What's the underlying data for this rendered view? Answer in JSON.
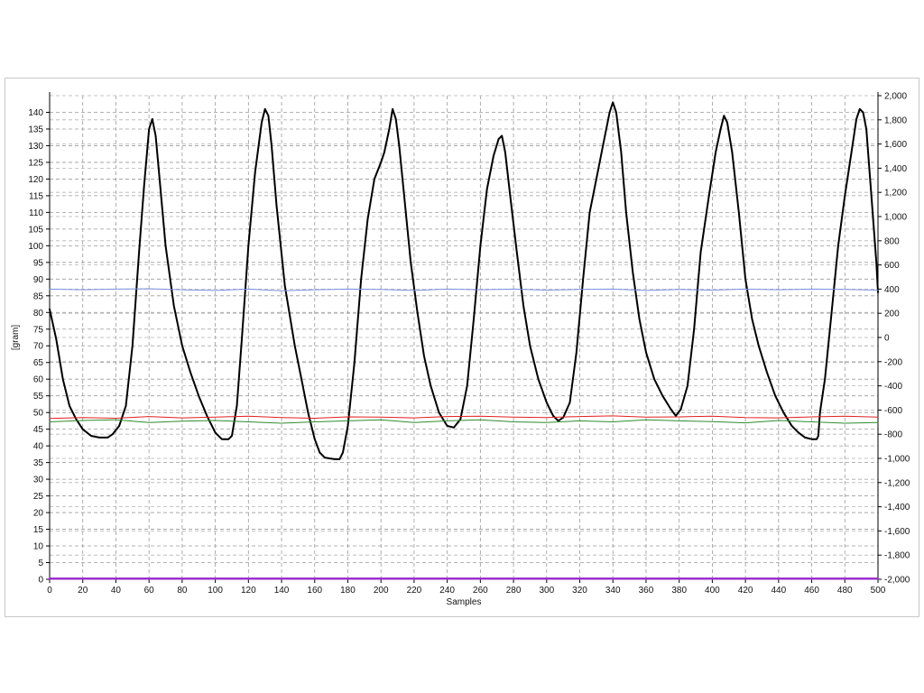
{
  "chart_data": {
    "type": "line",
    "title": "",
    "xlabel": "Samples",
    "ylabel": "[gram]",
    "xlim": [
      0,
      500
    ],
    "ylim": [
      0,
      145
    ],
    "y2lim": [
      -2000,
      2000
    ],
    "x_ticks": [
      "0",
      "20",
      "40",
      "60",
      "80",
      "100",
      "120",
      "140",
      "160",
      "180",
      "200",
      "220",
      "240",
      "260",
      "280",
      "300",
      "320",
      "340",
      "360",
      "380",
      "400",
      "420",
      "440",
      "460",
      "480",
      "500"
    ],
    "y_ticks": [
      "0",
      "5",
      "10",
      "15",
      "20",
      "25",
      "30",
      "35",
      "40",
      "45",
      "50",
      "55",
      "60",
      "65",
      "70",
      "75",
      "80",
      "85",
      "90",
      "95",
      "100",
      "105",
      "110",
      "115",
      "120",
      "125",
      "130",
      "135",
      "140"
    ],
    "y2_ticks": [
      "-2,000",
      "-1,800",
      "-1,600",
      "-1,400",
      "-1,200",
      "-1,000",
      "-800",
      "-600",
      "-400",
      "-200",
      "0",
      "200",
      "400",
      "600",
      "800",
      "1,000",
      "1,200",
      "1,400",
      "1,600",
      "1,800",
      "2,000"
    ],
    "grid": true,
    "series": [
      {
        "color": "#000000",
        "axis": "left",
        "points": [
          [
            0,
            81
          ],
          [
            4,
            72
          ],
          [
            8,
            60
          ],
          [
            12,
            52
          ],
          [
            16,
            48
          ],
          [
            20,
            45
          ],
          [
            25,
            43
          ],
          [
            30,
            42.5
          ],
          [
            35,
            42.5
          ],
          [
            38,
            43.5
          ],
          [
            42,
            46
          ],
          [
            46,
            52
          ],
          [
            50,
            70
          ],
          [
            54,
            98
          ],
          [
            57,
            118
          ],
          [
            60,
            135
          ],
          [
            62,
            138
          ],
          [
            64,
            133
          ],
          [
            66,
            122
          ],
          [
            70,
            100
          ],
          [
            75,
            82
          ],
          [
            80,
            70
          ],
          [
            85,
            62
          ],
          [
            90,
            55
          ],
          [
            95,
            49
          ],
          [
            100,
            44
          ],
          [
            104,
            42
          ],
          [
            108,
            42
          ],
          [
            110,
            43
          ],
          [
            113,
            52
          ],
          [
            116,
            72
          ],
          [
            120,
            100
          ],
          [
            124,
            122
          ],
          [
            128,
            137
          ],
          [
            130,
            141
          ],
          [
            132,
            139
          ],
          [
            134,
            130
          ],
          [
            137,
            112
          ],
          [
            142,
            88
          ],
          [
            148,
            70
          ],
          [
            152,
            60
          ],
          [
            156,
            50
          ],
          [
            160,
            42
          ],
          [
            163,
            38
          ],
          [
            166,
            36.5
          ],
          [
            172,
            36
          ],
          [
            175,
            36
          ],
          [
            177,
            38
          ],
          [
            180,
            46
          ],
          [
            184,
            65
          ],
          [
            188,
            90
          ],
          [
            192,
            108
          ],
          [
            196,
            120
          ],
          [
            200,
            125
          ],
          [
            202,
            128
          ],
          [
            205,
            135
          ],
          [
            207,
            141
          ],
          [
            209,
            138
          ],
          [
            211,
            130
          ],
          [
            214,
            115
          ],
          [
            218,
            95
          ],
          [
            222,
            80
          ],
          [
            226,
            67
          ],
          [
            230,
            58
          ],
          [
            235,
            50
          ],
          [
            240,
            46
          ],
          [
            244,
            45.5
          ],
          [
            248,
            48
          ],
          [
            252,
            58
          ],
          [
            256,
            78
          ],
          [
            260,
            100
          ],
          [
            264,
            117
          ],
          [
            268,
            127
          ],
          [
            271,
            132
          ],
          [
            273,
            133
          ],
          [
            275,
            128
          ],
          [
            278,
            115
          ],
          [
            282,
            98
          ],
          [
            286,
            82
          ],
          [
            290,
            70
          ],
          [
            295,
            60
          ],
          [
            300,
            53
          ],
          [
            304,
            49
          ],
          [
            307,
            47.5
          ],
          [
            310,
            48.5
          ],
          [
            314,
            53
          ],
          [
            318,
            68
          ],
          [
            322,
            90
          ],
          [
            326,
            110
          ],
          [
            330,
            120
          ],
          [
            334,
            130
          ],
          [
            338,
            140
          ],
          [
            340,
            143
          ],
          [
            342,
            140
          ],
          [
            345,
            128
          ],
          [
            348,
            110
          ],
          [
            352,
            92
          ],
          [
            356,
            78
          ],
          [
            360,
            68
          ],
          [
            365,
            60
          ],
          [
            370,
            55
          ],
          [
            375,
            51
          ],
          [
            378,
            49
          ],
          [
            381,
            51
          ],
          [
            385,
            58
          ],
          [
            389,
            75
          ],
          [
            393,
            98
          ],
          [
            398,
            115
          ],
          [
            402,
            128
          ],
          [
            405,
            135
          ],
          [
            407,
            139
          ],
          [
            409,
            137
          ],
          [
            412,
            128
          ],
          [
            416,
            110
          ],
          [
            420,
            90
          ],
          [
            424,
            78
          ],
          [
            428,
            70
          ],
          [
            433,
            62
          ],
          [
            438,
            55
          ],
          [
            443,
            50
          ],
          [
            448,
            46
          ],
          [
            452,
            44
          ],
          [
            456,
            42.5
          ],
          [
            460,
            42
          ],
          [
            463,
            42
          ],
          [
            464,
            43
          ],
          [
            465,
            50
          ],
          [
            468,
            60
          ],
          [
            472,
            80
          ],
          [
            476,
            100
          ],
          [
            480,
            115
          ],
          [
            484,
            128
          ],
          [
            487,
            138
          ],
          [
            489,
            141
          ],
          [
            491,
            140
          ],
          [
            493,
            135
          ],
          [
            496,
            115
          ],
          [
            499,
            95
          ],
          [
            500,
            86
          ]
        ]
      },
      {
        "color": "#7b8fe0",
        "axis": "left",
        "points": [
          [
            0,
            87
          ],
          [
            20,
            86.8
          ],
          [
            40,
            87
          ],
          [
            60,
            87.1
          ],
          [
            80,
            86.8
          ],
          [
            100,
            86.6
          ],
          [
            120,
            87
          ],
          [
            140,
            86.5
          ],
          [
            160,
            86.8
          ],
          [
            180,
            87
          ],
          [
            200,
            86.9
          ],
          [
            220,
            86.6
          ],
          [
            240,
            87
          ],
          [
            260,
            86.8
          ],
          [
            280,
            87
          ],
          [
            300,
            86.7
          ],
          [
            320,
            86.9
          ],
          [
            340,
            87
          ],
          [
            360,
            86.6
          ],
          [
            380,
            86.9
          ],
          [
            400,
            86.7
          ],
          [
            420,
            87
          ],
          [
            440,
            86.8
          ],
          [
            460,
            87
          ],
          [
            480,
            86.9
          ],
          [
            500,
            86.7
          ]
        ]
      },
      {
        "color": "#e02020",
        "axis": "left",
        "points": [
          [
            0,
            48.2
          ],
          [
            20,
            48.5
          ],
          [
            40,
            48.3
          ],
          [
            60,
            48.8
          ],
          [
            80,
            48.4
          ],
          [
            100,
            48.6
          ],
          [
            120,
            48.9
          ],
          [
            140,
            48.5
          ],
          [
            160,
            48.3
          ],
          [
            180,
            48.7
          ],
          [
            200,
            48.6
          ],
          [
            220,
            48.4
          ],
          [
            240,
            48.8
          ],
          [
            260,
            48.9
          ],
          [
            280,
            48.6
          ],
          [
            300,
            48.5
          ],
          [
            320,
            48.8
          ],
          [
            340,
            49
          ],
          [
            360,
            48.6
          ],
          [
            380,
            48.7
          ],
          [
            400,
            48.9
          ],
          [
            420,
            48.5
          ],
          [
            440,
            48.4
          ],
          [
            460,
            48.7
          ],
          [
            480,
            48.9
          ],
          [
            500,
            48.6
          ]
        ]
      },
      {
        "color": "#2e8b2e",
        "axis": "left",
        "points": [
          [
            0,
            47.2
          ],
          [
            20,
            47.6
          ],
          [
            40,
            47.8
          ],
          [
            60,
            47
          ],
          [
            80,
            47.4
          ],
          [
            100,
            47.6
          ],
          [
            120,
            47.2
          ],
          [
            140,
            46.8
          ],
          [
            160,
            47.2
          ],
          [
            180,
            47.5
          ],
          [
            200,
            47.8
          ],
          [
            220,
            47
          ],
          [
            240,
            47.5
          ],
          [
            260,
            47.8
          ],
          [
            280,
            47.2
          ],
          [
            300,
            47
          ],
          [
            320,
            47.5
          ],
          [
            340,
            47.2
          ],
          [
            360,
            47.8
          ],
          [
            380,
            47.5
          ],
          [
            400,
            47.3
          ],
          [
            420,
            46.9
          ],
          [
            440,
            47.6
          ],
          [
            460,
            47.2
          ],
          [
            480,
            46.8
          ],
          [
            500,
            47
          ]
        ]
      },
      {
        "color": "#9b30d0",
        "axis": "left",
        "points": [
          [
            0,
            0.2
          ],
          [
            500,
            0.2
          ]
        ]
      }
    ]
  }
}
